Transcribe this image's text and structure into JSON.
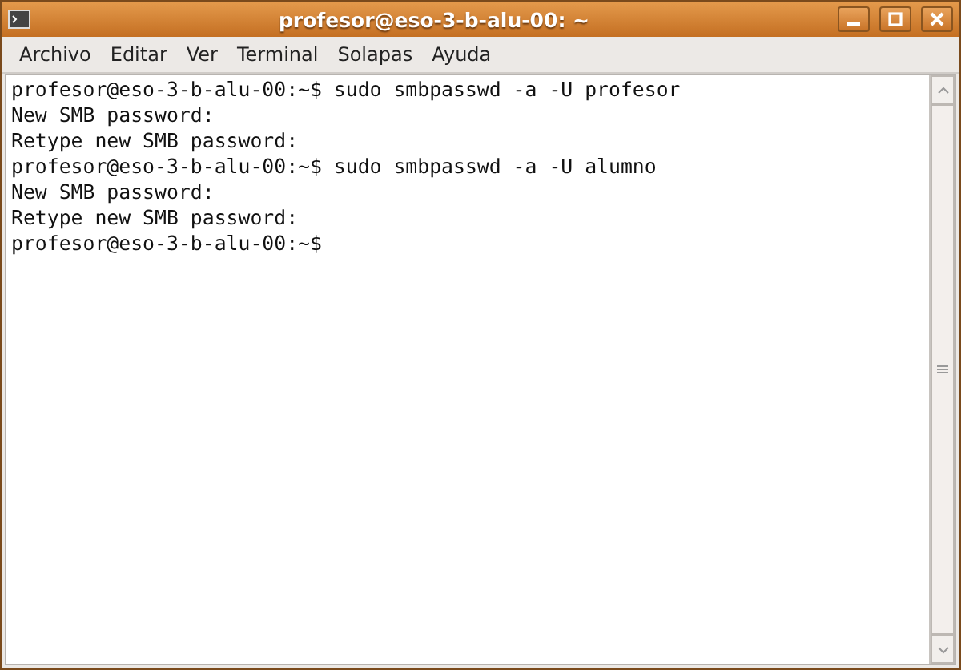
{
  "window": {
    "title": "profesor@eso-3-b-alu-00: ~"
  },
  "menu": [
    "Archivo",
    "Editar",
    "Ver",
    "Terminal",
    "Solapas",
    "Ayuda"
  ],
  "terminal": {
    "lines": [
      "profesor@eso-3-b-alu-00:~$ sudo smbpasswd -a -U profesor",
      "New SMB password:",
      "Retype new SMB password:",
      "profesor@eso-3-b-alu-00:~$ sudo smbpasswd -a -U alumno",
      "New SMB password:",
      "Retype new SMB password:",
      "profesor@eso-3-b-alu-00:~$"
    ]
  }
}
